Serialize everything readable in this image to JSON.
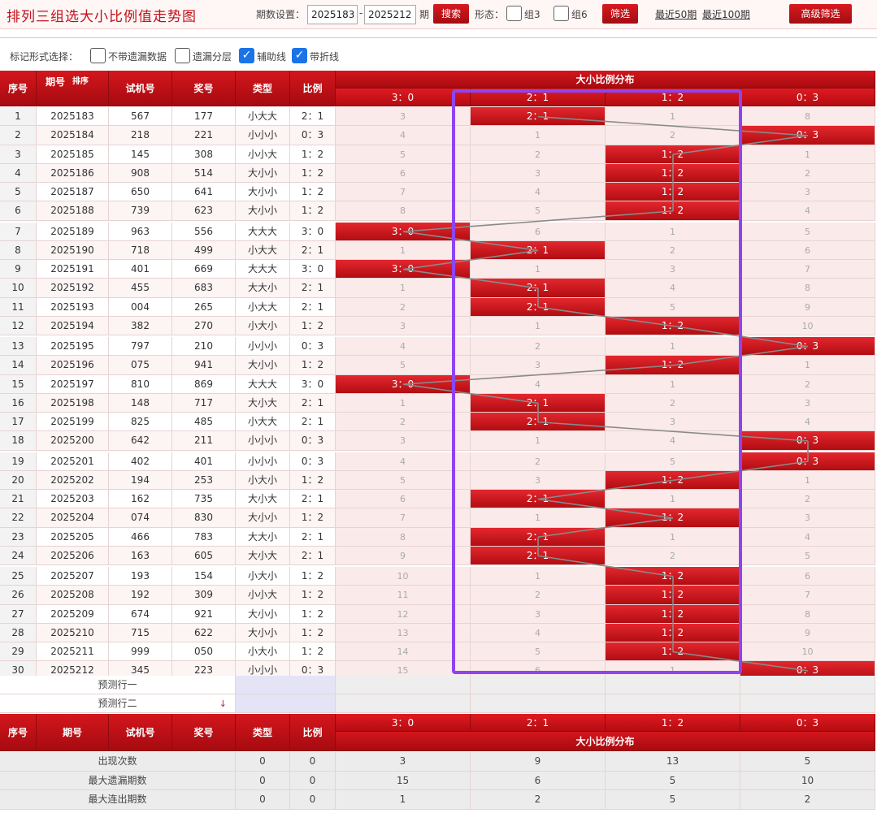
{
  "header": {
    "title": "排列三组选大小比例值走势图",
    "period_label": "期数设置：",
    "period_from": "2025183",
    "period_sep": "-",
    "period_to": "2025212",
    "period_unit": "期",
    "search_button": "搜索",
    "form_label": "形态：",
    "group3_label": "组3",
    "group6_label": "组6",
    "filter_button": "筛选",
    "recent50_link": "最近50期",
    "recent100_link": "最近100期",
    "advanced_button": "高级筛选"
  },
  "options": {
    "label": "标记形式选择：",
    "items": [
      {
        "label": "不带遗漏数据",
        "checked": false
      },
      {
        "label": "遗漏分层",
        "checked": false
      },
      {
        "label": "辅助线",
        "checked": true
      },
      {
        "label": "带折线",
        "checked": true
      }
    ]
  },
  "table": {
    "col_headers": {
      "index": "序号",
      "period": "期号",
      "sort": "排序",
      "trial": "试机号",
      "prize": "奖号",
      "type": "类型",
      "ratio": "比例",
      "dist_title": "大小比例分布"
    },
    "dist_cols": [
      "3：0",
      "2：1",
      "1：2",
      "0：3"
    ],
    "rows": [
      {
        "no": "1",
        "period": "2025183",
        "trial": "567",
        "prize": "177",
        "type": "小大大",
        "ratio": "2：1",
        "dist": [
          "3",
          "2：1",
          "1",
          "8"
        ],
        "hit": 1
      },
      {
        "no": "2",
        "period": "2025184",
        "trial": "218",
        "prize": "221",
        "type": "小小小",
        "ratio": "0：3",
        "dist": [
          "4",
          "1",
          "2",
          "0：3"
        ],
        "hit": 3
      },
      {
        "no": "3",
        "period": "2025185",
        "trial": "145",
        "prize": "308",
        "type": "小小大",
        "ratio": "1：2",
        "dist": [
          "5",
          "2",
          "1：2",
          "1"
        ],
        "hit": 2
      },
      {
        "no": "4",
        "period": "2025186",
        "trial": "908",
        "prize": "514",
        "type": "大小小",
        "ratio": "1：2",
        "dist": [
          "6",
          "3",
          "1：2",
          "2"
        ],
        "hit": 2
      },
      {
        "no": "5",
        "period": "2025187",
        "trial": "650",
        "prize": "641",
        "type": "大小小",
        "ratio": "1：2",
        "dist": [
          "7",
          "4",
          "1：2",
          "3"
        ],
        "hit": 2
      },
      {
        "no": "6",
        "period": "2025188",
        "trial": "739",
        "prize": "623",
        "type": "大小小",
        "ratio": "1：2",
        "dist": [
          "8",
          "5",
          "1：2",
          "4"
        ],
        "hit": 2
      },
      {
        "no": "7",
        "period": "2025189",
        "trial": "963",
        "prize": "556",
        "type": "大大大",
        "ratio": "3：0",
        "dist": [
          "3：0",
          "6",
          "1",
          "5"
        ],
        "hit": 0
      },
      {
        "no": "8",
        "period": "2025190",
        "trial": "718",
        "prize": "499",
        "type": "小大大",
        "ratio": "2：1",
        "dist": [
          "1",
          "2：1",
          "2",
          "6"
        ],
        "hit": 1
      },
      {
        "no": "9",
        "period": "2025191",
        "trial": "401",
        "prize": "669",
        "type": "大大大",
        "ratio": "3：0",
        "dist": [
          "3：0",
          "1",
          "3",
          "7"
        ],
        "hit": 0
      },
      {
        "no": "10",
        "period": "2025192",
        "trial": "455",
        "prize": "683",
        "type": "大大小",
        "ratio": "2：1",
        "dist": [
          "1",
          "2：1",
          "4",
          "8"
        ],
        "hit": 1
      },
      {
        "no": "11",
        "period": "2025193",
        "trial": "004",
        "prize": "265",
        "type": "小大大",
        "ratio": "2：1",
        "dist": [
          "2",
          "2：1",
          "5",
          "9"
        ],
        "hit": 1
      },
      {
        "no": "12",
        "period": "2025194",
        "trial": "382",
        "prize": "270",
        "type": "小大小",
        "ratio": "1：2",
        "dist": [
          "3",
          "1",
          "1：2",
          "10"
        ],
        "hit": 2
      },
      {
        "no": "13",
        "period": "2025195",
        "trial": "797",
        "prize": "210",
        "type": "小小小",
        "ratio": "0：3",
        "dist": [
          "4",
          "2",
          "1",
          "0：3"
        ],
        "hit": 3
      },
      {
        "no": "14",
        "period": "2025196",
        "trial": "075",
        "prize": "941",
        "type": "大小小",
        "ratio": "1：2",
        "dist": [
          "5",
          "3",
          "1：2",
          "1"
        ],
        "hit": 2
      },
      {
        "no": "15",
        "period": "2025197",
        "trial": "810",
        "prize": "869",
        "type": "大大大",
        "ratio": "3：0",
        "dist": [
          "3：0",
          "4",
          "1",
          "2"
        ],
        "hit": 0
      },
      {
        "no": "16",
        "period": "2025198",
        "trial": "148",
        "prize": "717",
        "type": "大小大",
        "ratio": "2：1",
        "dist": [
          "1",
          "2：1",
          "2",
          "3"
        ],
        "hit": 1
      },
      {
        "no": "17",
        "period": "2025199",
        "trial": "825",
        "prize": "485",
        "type": "小大大",
        "ratio": "2：1",
        "dist": [
          "2",
          "2：1",
          "3",
          "4"
        ],
        "hit": 1
      },
      {
        "no": "18",
        "period": "2025200",
        "trial": "642",
        "prize": "211",
        "type": "小小小",
        "ratio": "0：3",
        "dist": [
          "3",
          "1",
          "4",
          "0：3"
        ],
        "hit": 3
      },
      {
        "no": "19",
        "period": "2025201",
        "trial": "402",
        "prize": "401",
        "type": "小小小",
        "ratio": "0：3",
        "dist": [
          "4",
          "2",
          "5",
          "0：3"
        ],
        "hit": 3
      },
      {
        "no": "20",
        "period": "2025202",
        "trial": "194",
        "prize": "253",
        "type": "小大小",
        "ratio": "1：2",
        "dist": [
          "5",
          "3",
          "1：2",
          "1"
        ],
        "hit": 2
      },
      {
        "no": "21",
        "period": "2025203",
        "trial": "162",
        "prize": "735",
        "type": "大小大",
        "ratio": "2：1",
        "dist": [
          "6",
          "2：1",
          "1",
          "2"
        ],
        "hit": 1
      },
      {
        "no": "22",
        "period": "2025204",
        "trial": "074",
        "prize": "830",
        "type": "大小小",
        "ratio": "1：2",
        "dist": [
          "7",
          "1",
          "1：2",
          "3"
        ],
        "hit": 2
      },
      {
        "no": "23",
        "period": "2025205",
        "trial": "466",
        "prize": "783",
        "type": "大大小",
        "ratio": "2：1",
        "dist": [
          "8",
          "2：1",
          "1",
          "4"
        ],
        "hit": 1
      },
      {
        "no": "24",
        "period": "2025206",
        "trial": "163",
        "prize": "605",
        "type": "大小大",
        "ratio": "2：1",
        "dist": [
          "9",
          "2：1",
          "2",
          "5"
        ],
        "hit": 1
      },
      {
        "no": "25",
        "period": "2025207",
        "trial": "193",
        "prize": "154",
        "type": "小大小",
        "ratio": "1：2",
        "dist": [
          "10",
          "1",
          "1：2",
          "6"
        ],
        "hit": 2
      },
      {
        "no": "26",
        "period": "2025208",
        "trial": "192",
        "prize": "309",
        "type": "小小大",
        "ratio": "1：2",
        "dist": [
          "11",
          "2",
          "1：2",
          "7"
        ],
        "hit": 2
      },
      {
        "no": "27",
        "period": "2025209",
        "trial": "674",
        "prize": "921",
        "type": "大小小",
        "ratio": "1：2",
        "dist": [
          "12",
          "3",
          "1：2",
          "8"
        ],
        "hit": 2
      },
      {
        "no": "28",
        "period": "2025210",
        "trial": "715",
        "prize": "622",
        "type": "大小小",
        "ratio": "1：2",
        "dist": [
          "13",
          "4",
          "1：2",
          "9"
        ],
        "hit": 2
      },
      {
        "no": "29",
        "period": "2025211",
        "trial": "999",
        "prize": "050",
        "type": "小大小",
        "ratio": "1：2",
        "dist": [
          "14",
          "5",
          "1：2",
          "10"
        ],
        "hit": 2
      },
      {
        "no": "30",
        "period": "2025212",
        "trial": "345",
        "prize": "223",
        "type": "小小小",
        "ratio": "0：3",
        "dist": [
          "15",
          "6",
          "1",
          "0：3"
        ],
        "hit": 3
      }
    ],
    "predict": [
      "预测行一",
      "预测行二"
    ],
    "footer_headers": {
      "index": "序号",
      "period": "期号",
      "trial": "试机号",
      "prize": "奖号",
      "type": "类型",
      "ratio": "比例",
      "dist_title": "大小比例分布"
    },
    "stats": [
      {
        "label": "出现次数",
        "values": [
          "0",
          "0",
          "3",
          "9",
          "13",
          "5"
        ]
      },
      {
        "label": "最大遗漏期数",
        "values": [
          "0",
          "0",
          "15",
          "6",
          "5",
          "10"
        ]
      },
      {
        "label": "最大连出期数",
        "values": [
          "0",
          "0",
          "1",
          "2",
          "5",
          "2"
        ]
      }
    ]
  },
  "colors": {
    "accent": "#c0121b",
    "highlight": "#8e44f0",
    "checkbox_on": "#1a73e8"
  }
}
